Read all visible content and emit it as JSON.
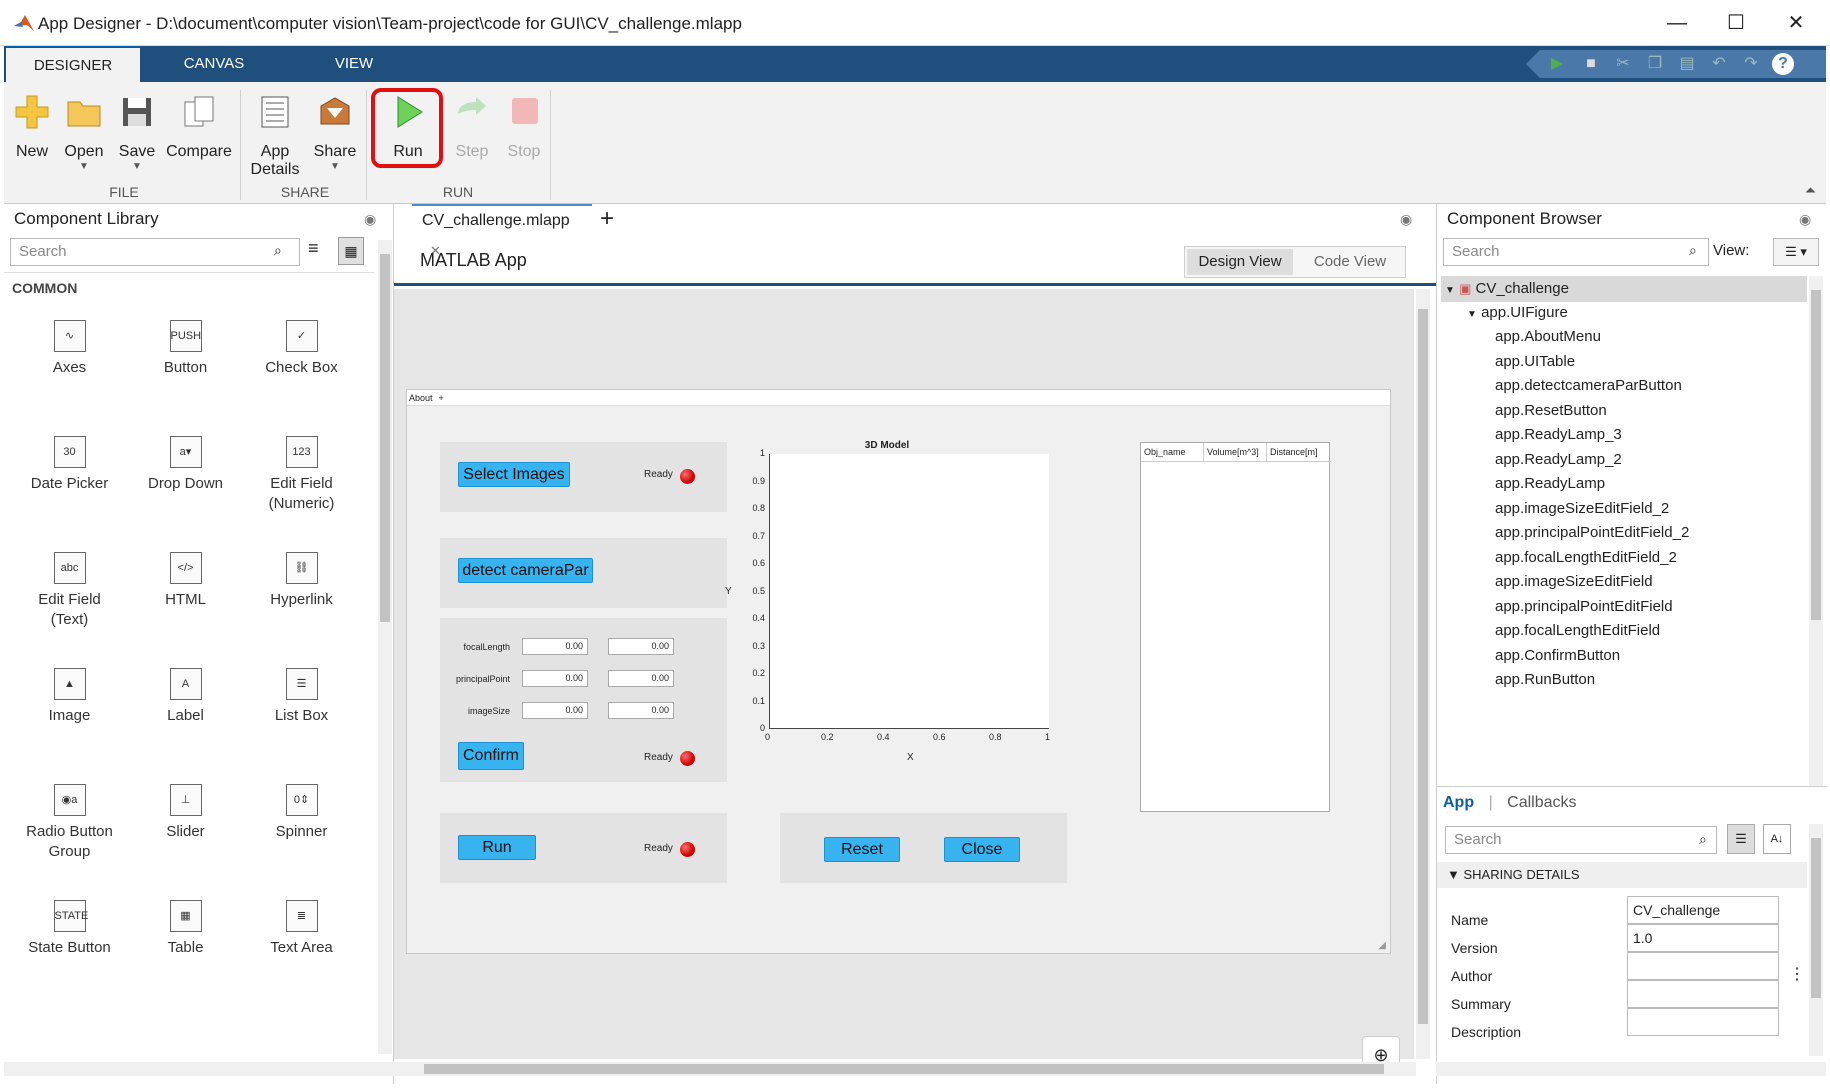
{
  "window": {
    "title": "App Designer - D:\\document\\computer vision\\Team-project\\code for GUI\\CV_challenge.mlapp",
    "minimize": "—",
    "maximize": "☐",
    "close": "✕"
  },
  "ribbon_tabs": [
    "DESIGNER",
    "CANVAS",
    "VIEW"
  ],
  "ribbon": {
    "file": {
      "new": "New",
      "open": "Open",
      "save": "Save",
      "compare": "Compare",
      "group": "FILE"
    },
    "share": {
      "app_details_1": "App",
      "app_details_2": "Details",
      "share": "Share",
      "group": "SHARE"
    },
    "run": {
      "run": "Run",
      "step": "Step",
      "stop": "Stop",
      "group": "RUN"
    }
  },
  "library": {
    "title": "Component Library",
    "search_placeholder": "Search",
    "section": "COMMON",
    "items": [
      {
        "label": "Axes",
        "icon": "axes-icon"
      },
      {
        "label": "Button",
        "icon": "button-icon"
      },
      {
        "label": "Check Box",
        "icon": "checkbox-icon"
      },
      {
        "label": "Date Picker",
        "icon": "date-picker-icon"
      },
      {
        "label": "Drop Down",
        "icon": "dropdown-icon"
      },
      {
        "label": "Edit Field\n(Numeric)",
        "icon": "numeric-field-icon"
      },
      {
        "label": "Edit Field\n(Text)",
        "icon": "text-field-icon"
      },
      {
        "label": "HTML",
        "icon": "html-icon"
      },
      {
        "label": "Hyperlink",
        "icon": "hyperlink-icon"
      },
      {
        "label": "Image",
        "icon": "image-icon"
      },
      {
        "label": "Label",
        "icon": "label-icon"
      },
      {
        "label": "List Box",
        "icon": "listbox-icon"
      },
      {
        "label": "Radio Button\nGroup",
        "icon": "radio-group-icon"
      },
      {
        "label": "Slider",
        "icon": "slider-icon"
      },
      {
        "label": "Spinner",
        "icon": "spinner-icon"
      },
      {
        "label": "State Button",
        "icon": "state-button-icon"
      },
      {
        "label": "Table",
        "icon": "table-icon"
      },
      {
        "label": "Text Area",
        "icon": "textarea-icon"
      }
    ]
  },
  "document": {
    "tab": "CV_challenge.mlapp",
    "header": "MATLAB App",
    "design_view": "Design View",
    "code_view": "Code View"
  },
  "app": {
    "menu": "About",
    "select_images": "Select Images",
    "detect_camera": "detect cameraPar",
    "confirm": "Confirm",
    "run": "Run",
    "reset": "Reset",
    "close": "Close",
    "ready": "Ready",
    "fields": [
      {
        "label": "focalLength",
        "v1": "0.00",
        "v2": "0.00"
      },
      {
        "label": "principalPoint",
        "v1": "0.00",
        "v2": "0.00"
      },
      {
        "label": "imageSize",
        "v1": "0.00",
        "v2": "0.00"
      }
    ],
    "plot": {
      "title": "3D Model",
      "xlabel": "X",
      "ylabel": "Y",
      "yticks": [
        "1",
        "0.9",
        "0.8",
        "0.7",
        "0.6",
        "0.5",
        "0.4",
        "0.3",
        "0.2",
        "0.1",
        "0"
      ],
      "xticks": [
        "0",
        "0.2",
        "0.4",
        "0.6",
        "0.8",
        "1"
      ]
    },
    "table_headers": [
      "Obj_name",
      "Volume[m^3]",
      "Distance[m]"
    ]
  },
  "browser": {
    "title": "Component Browser",
    "search_placeholder": "Search",
    "view_label": "View:",
    "tree_root": "CV_challenge",
    "tree_figure": "app.UIFigure",
    "tree_children": [
      "app.AboutMenu",
      "app.UITable",
      "app.detectcameraParButton",
      "app.ResetButton",
      "app.ReadyLamp_3",
      "app.ReadyLamp_2",
      "app.ReadyLamp",
      "app.imageSizeEditField_2",
      "app.principalPointEditField_2",
      "app.focalLengthEditField_2",
      "app.imageSizeEditField",
      "app.principalPointEditField",
      "app.focalLengthEditField",
      "app.ConfirmButton",
      "app.RunButton"
    ],
    "prop_tabs": {
      "app": "App",
      "callbacks": "Callbacks"
    },
    "prop_search_placeholder": "Search",
    "section": "SHARING DETAILS",
    "props": [
      {
        "label": "Name",
        "value": "CV_challenge"
      },
      {
        "label": "Version",
        "value": "1.0"
      },
      {
        "label": "Author",
        "value": ""
      },
      {
        "label": "Summary",
        "value": ""
      },
      {
        "label": "Description",
        "value": ""
      }
    ]
  }
}
